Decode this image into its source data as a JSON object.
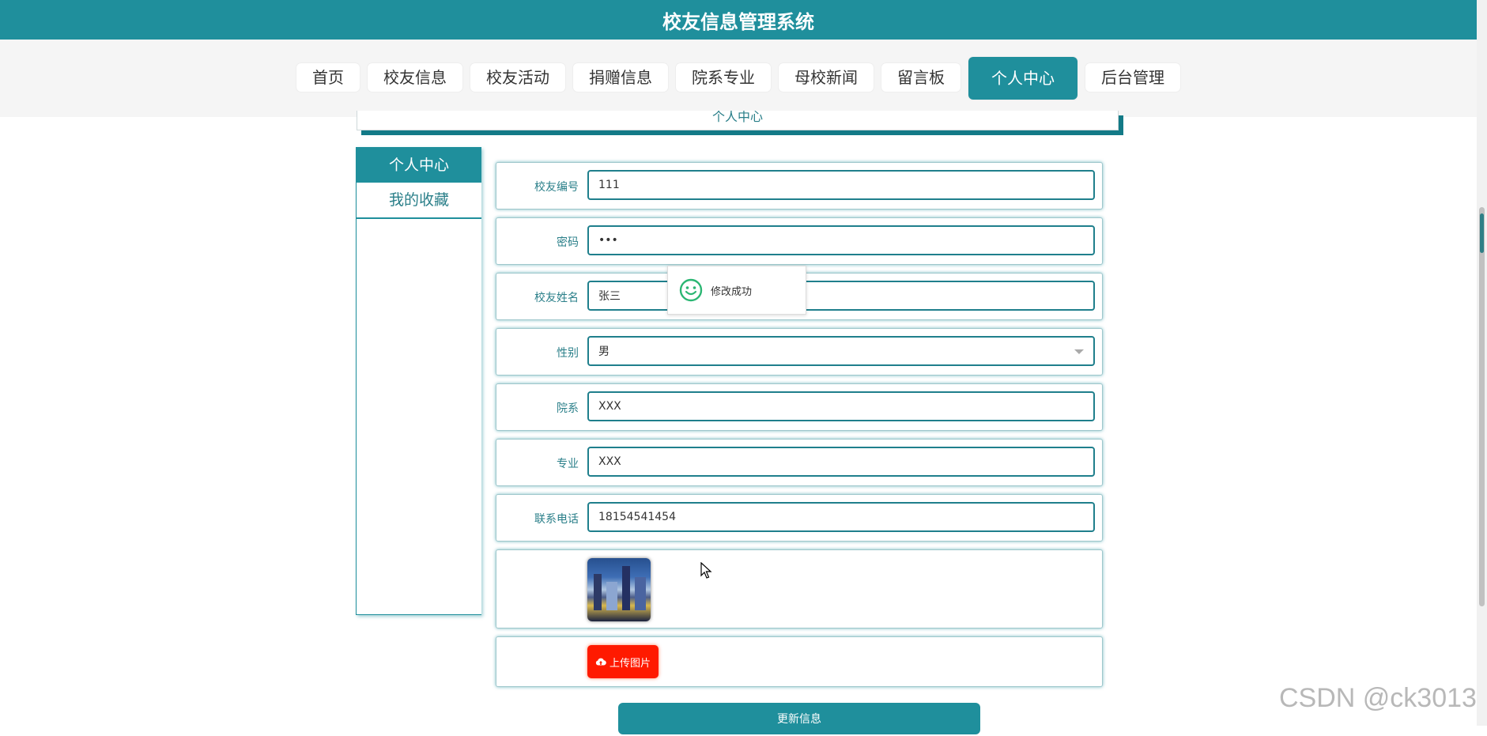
{
  "app": {
    "title": "校友信息管理系统"
  },
  "nav": {
    "items": [
      "首页",
      "校友信息",
      "校友活动",
      "捐赠信息",
      "院系专业",
      "母校新闻",
      "留言板",
      "个人中心",
      "后台管理"
    ],
    "active_index": 7
  },
  "breadcrumb": {
    "text": "个人中心"
  },
  "sidebar": {
    "header": "个人中心",
    "items": [
      "我的收藏"
    ]
  },
  "form": {
    "fields": [
      {
        "label": "校友编号",
        "value": "111"
      },
      {
        "label": "密码",
        "value": "•••"
      },
      {
        "label": "校友姓名",
        "value": "张三"
      },
      {
        "label": "性别",
        "value": "男"
      },
      {
        "label": "院系",
        "value": "XXX"
      },
      {
        "label": "专业",
        "value": "XXX"
      },
      {
        "label": "联系电话",
        "value": "18154541454"
      }
    ],
    "upload_label": "上传图片",
    "submit_label": "更新信息"
  },
  "toast": {
    "text": "修改成功",
    "icon": "smile-icon"
  },
  "watermark": "CSDN @ck3013",
  "colors": {
    "primary": "#1f8f9c",
    "upload": "#ff1a00",
    "background": "#ffffff"
  }
}
